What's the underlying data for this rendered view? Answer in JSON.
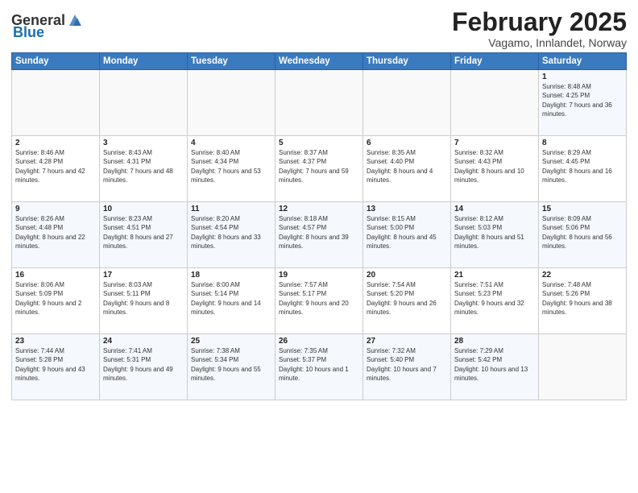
{
  "logo": {
    "general": "General",
    "blue": "Blue"
  },
  "header": {
    "month": "February 2025",
    "location": "Vagamo, Innlandet, Norway"
  },
  "weekdays": [
    "Sunday",
    "Monday",
    "Tuesday",
    "Wednesday",
    "Thursday",
    "Friday",
    "Saturday"
  ],
  "weeks": [
    [
      {
        "day": "",
        "info": ""
      },
      {
        "day": "",
        "info": ""
      },
      {
        "day": "",
        "info": ""
      },
      {
        "day": "",
        "info": ""
      },
      {
        "day": "",
        "info": ""
      },
      {
        "day": "",
        "info": ""
      },
      {
        "day": "1",
        "info": "Sunrise: 8:48 AM\nSunset: 4:25 PM\nDaylight: 7 hours and 36 minutes."
      }
    ],
    [
      {
        "day": "2",
        "info": "Sunrise: 8:46 AM\nSunset: 4:28 PM\nDaylight: 7 hours and 42 minutes."
      },
      {
        "day": "3",
        "info": "Sunrise: 8:43 AM\nSunset: 4:31 PM\nDaylight: 7 hours and 48 minutes."
      },
      {
        "day": "4",
        "info": "Sunrise: 8:40 AM\nSunset: 4:34 PM\nDaylight: 7 hours and 53 minutes."
      },
      {
        "day": "5",
        "info": "Sunrise: 8:37 AM\nSunset: 4:37 PM\nDaylight: 7 hours and 59 minutes."
      },
      {
        "day": "6",
        "info": "Sunrise: 8:35 AM\nSunset: 4:40 PM\nDaylight: 8 hours and 4 minutes."
      },
      {
        "day": "7",
        "info": "Sunrise: 8:32 AM\nSunset: 4:43 PM\nDaylight: 8 hours and 10 minutes."
      },
      {
        "day": "8",
        "info": "Sunrise: 8:29 AM\nSunset: 4:45 PM\nDaylight: 8 hours and 16 minutes."
      }
    ],
    [
      {
        "day": "9",
        "info": "Sunrise: 8:26 AM\nSunset: 4:48 PM\nDaylight: 8 hours and 22 minutes."
      },
      {
        "day": "10",
        "info": "Sunrise: 8:23 AM\nSunset: 4:51 PM\nDaylight: 8 hours and 27 minutes."
      },
      {
        "day": "11",
        "info": "Sunrise: 8:20 AM\nSunset: 4:54 PM\nDaylight: 8 hours and 33 minutes."
      },
      {
        "day": "12",
        "info": "Sunrise: 8:18 AM\nSunset: 4:57 PM\nDaylight: 8 hours and 39 minutes."
      },
      {
        "day": "13",
        "info": "Sunrise: 8:15 AM\nSunset: 5:00 PM\nDaylight: 8 hours and 45 minutes."
      },
      {
        "day": "14",
        "info": "Sunrise: 8:12 AM\nSunset: 5:03 PM\nDaylight: 8 hours and 51 minutes."
      },
      {
        "day": "15",
        "info": "Sunrise: 8:09 AM\nSunset: 5:06 PM\nDaylight: 8 hours and 56 minutes."
      }
    ],
    [
      {
        "day": "16",
        "info": "Sunrise: 8:06 AM\nSunset: 5:09 PM\nDaylight: 9 hours and 2 minutes."
      },
      {
        "day": "17",
        "info": "Sunrise: 8:03 AM\nSunset: 5:11 PM\nDaylight: 9 hours and 8 minutes."
      },
      {
        "day": "18",
        "info": "Sunrise: 8:00 AM\nSunset: 5:14 PM\nDaylight: 9 hours and 14 minutes."
      },
      {
        "day": "19",
        "info": "Sunrise: 7:57 AM\nSunset: 5:17 PM\nDaylight: 9 hours and 20 minutes."
      },
      {
        "day": "20",
        "info": "Sunrise: 7:54 AM\nSunset: 5:20 PM\nDaylight: 9 hours and 26 minutes."
      },
      {
        "day": "21",
        "info": "Sunrise: 7:51 AM\nSunset: 5:23 PM\nDaylight: 9 hours and 32 minutes."
      },
      {
        "day": "22",
        "info": "Sunrise: 7:48 AM\nSunset: 5:26 PM\nDaylight: 9 hours and 38 minutes."
      }
    ],
    [
      {
        "day": "23",
        "info": "Sunrise: 7:44 AM\nSunset: 5:28 PM\nDaylight: 9 hours and 43 minutes."
      },
      {
        "day": "24",
        "info": "Sunrise: 7:41 AM\nSunset: 5:31 PM\nDaylight: 9 hours and 49 minutes."
      },
      {
        "day": "25",
        "info": "Sunrise: 7:38 AM\nSunset: 5:34 PM\nDaylight: 9 hours and 55 minutes."
      },
      {
        "day": "26",
        "info": "Sunrise: 7:35 AM\nSunset: 5:37 PM\nDaylight: 10 hours and 1 minute."
      },
      {
        "day": "27",
        "info": "Sunrise: 7:32 AM\nSunset: 5:40 PM\nDaylight: 10 hours and 7 minutes."
      },
      {
        "day": "28",
        "info": "Sunrise: 7:29 AM\nSunset: 5:42 PM\nDaylight: 10 hours and 13 minutes."
      },
      {
        "day": "",
        "info": ""
      }
    ]
  ]
}
